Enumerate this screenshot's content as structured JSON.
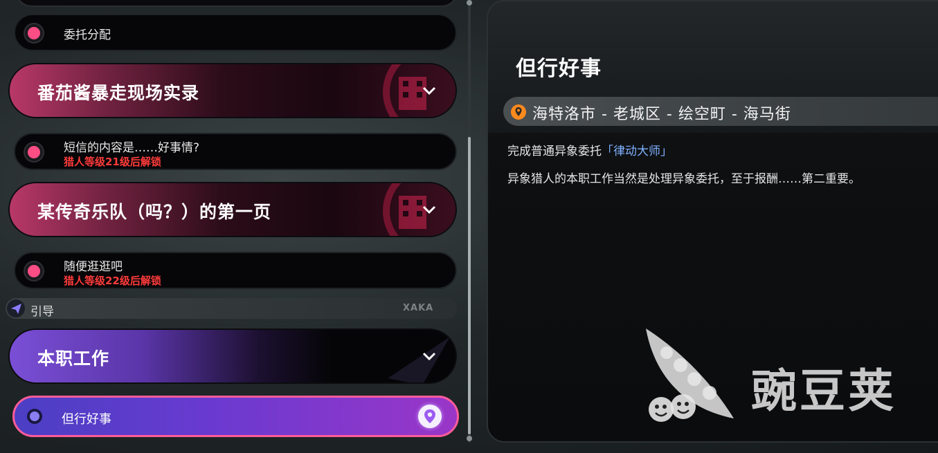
{
  "tasks": {
    "item_top": {
      "title": "委托分配"
    },
    "group_1": {
      "title": "番茄酱暴走现场实录"
    },
    "item_sms": {
      "title": "短信的内容是……好事情?",
      "lock": "猎人等级21级后解锁"
    },
    "group_2": {
      "title": "某传奇乐队（吗？）的第一页"
    },
    "item_stroll": {
      "title": "随便逛逛吧",
      "lock": "猎人等级22级后解锁"
    },
    "guide": {
      "label": "引导",
      "brand": "XAKA"
    },
    "group_3": {
      "title": "本职工作"
    },
    "active_item": {
      "title": "但行好事"
    }
  },
  "detail": {
    "title": "但行好事",
    "location": "海特洛市 - 老城区 - 绘空町 - 海马街",
    "objective_prefix": "完成普通异象委托",
    "objective_target": "「律动大师」",
    "description": "异象猎人的本职工作当然是处理异象委托，至于报酬……第二重要。"
  },
  "watermark": {
    "text": "豌豆荚"
  },
  "colors": {
    "accent_pink": "#ff4d86",
    "active_gradient_start": "#4b3fc4",
    "active_gradient_end": "#9a36c8",
    "lock_red": "#ff3b3b",
    "highlight_blue": "#7fb1ff",
    "location_orange": "#ff8a1e"
  },
  "icons": {
    "chevron": "chevron-down-icon",
    "pin": "location-pin-icon",
    "guide": "paper-plane-icon"
  }
}
